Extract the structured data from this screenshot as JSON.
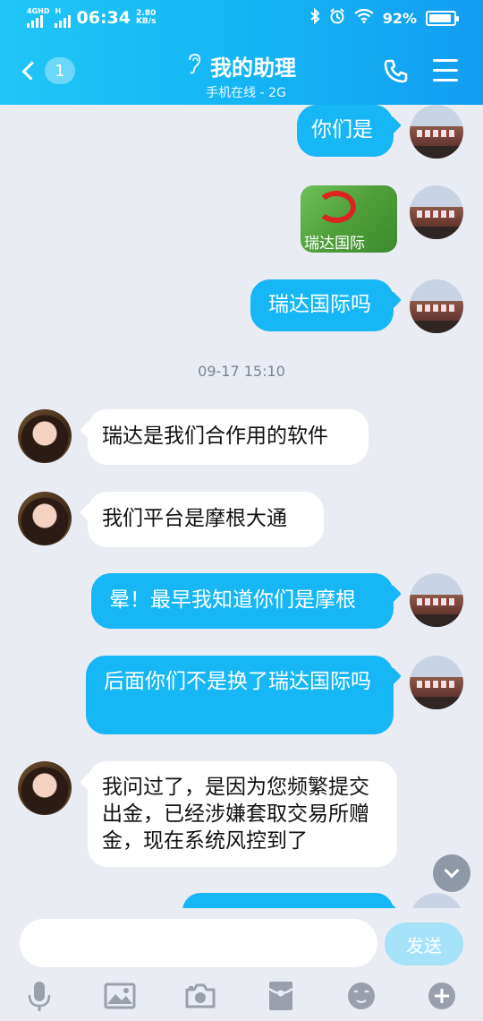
{
  "status_bar": {
    "network": "4GHD",
    "network2": "H",
    "time": "06:34",
    "speed_value": "2.80",
    "speed_unit": "KB/s",
    "battery": "92%",
    "battery_level": 0.92
  },
  "header": {
    "back_badge": "1",
    "title": "我的助理",
    "subtitle": "手机在线 - 2G"
  },
  "messages": [
    {
      "direction": "out",
      "text": "你们是"
    },
    {
      "direction": "out",
      "type": "image",
      "caption": "瑞达国际"
    },
    {
      "direction": "out",
      "text": "瑞达国际吗"
    },
    {
      "type": "timestamp",
      "text": "09-17 15:10"
    },
    {
      "direction": "in",
      "text": "瑞达是我们合作用的软件"
    },
    {
      "direction": "in",
      "text": "我们平台是摩根大通"
    },
    {
      "direction": "out",
      "text": "晕！最早我知道你们是摩根"
    },
    {
      "direction": "out",
      "text": "后面你们不是换了瑞达国际吗"
    },
    {
      "direction": "in",
      "text": "我问过了，是因为您频繁提交出金，已经涉嫌套取交易所赠金，现在系统风控到了"
    }
  ],
  "input": {
    "value": "",
    "send_label": "发送"
  },
  "toolbar_icons": [
    "microphone-icon",
    "image-icon",
    "camera-icon",
    "red-packet-icon",
    "emoji-icon",
    "plus-icon"
  ],
  "colors": {
    "accent": "#17b7f6",
    "header_start": "#20c6f7",
    "header_end": "#139df0",
    "background": "#e9ecf3"
  }
}
